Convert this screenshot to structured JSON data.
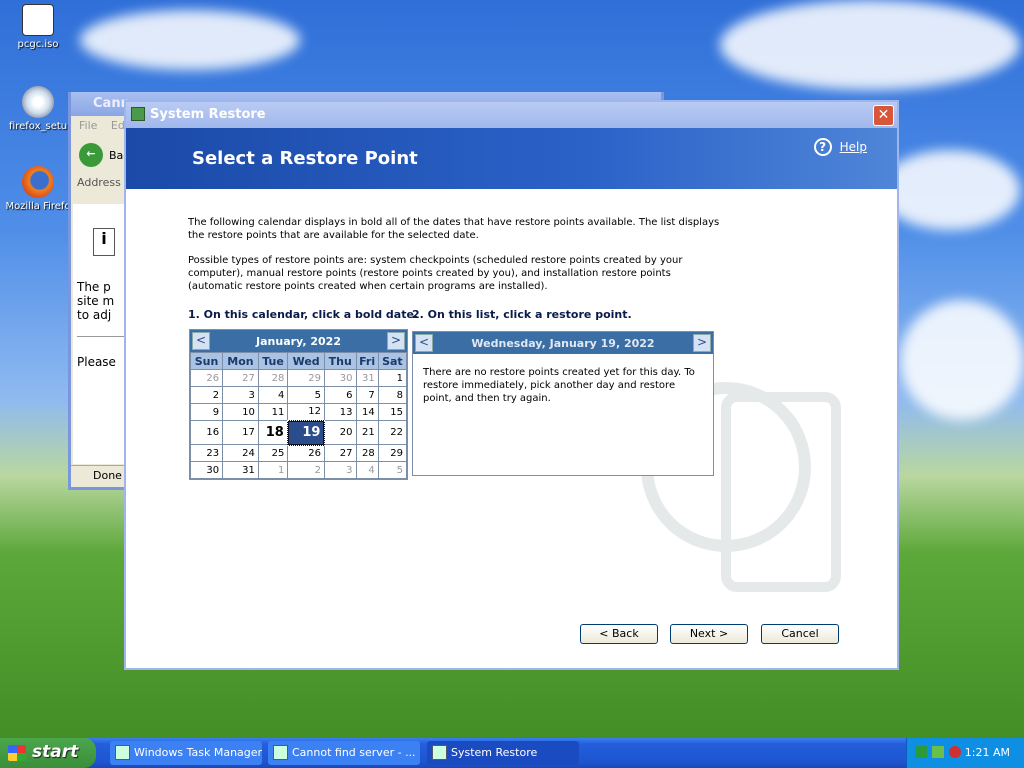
{
  "desktop": {
    "icons": [
      {
        "label": "pcgc.iso"
      },
      {
        "label": "firefox_setu"
      },
      {
        "label": "Mozilla Firefo"
      }
    ]
  },
  "ie_window": {
    "title": "Cann",
    "menu_file": "File",
    "menu_edit": "Ed",
    "back": "Bac",
    "address": "Address",
    "body_line1": "The p",
    "body_line2": "site m",
    "body_line3": "to adj",
    "body_line4": "Please",
    "status": "Done"
  },
  "system_restore": {
    "window_title": "System Restore",
    "close_label": "✕",
    "header_title": "Select a Restore Point",
    "help_label": "Help",
    "intro_p1": "The following calendar displays in bold all of the dates that have restore points available. The list displays the restore points that are available for the selected date.",
    "intro_p2": "Possible types of restore points are: system checkpoints (scheduled restore points created by your computer), manual restore points (restore points created by you), and installation restore points (automatic restore points created when certain programs are installed).",
    "step1": "1. On this calendar, click a bold date.",
    "step2": "2. On this list, click a restore point.",
    "calendar": {
      "month_label": "January, 2022",
      "prev": "<",
      "next": ">",
      "weekdays": [
        "Sun",
        "Mon",
        "Tue",
        "Wed",
        "Thu",
        "Fri",
        "Sat"
      ],
      "weeks": [
        [
          "26",
          "27",
          "28",
          "29",
          "30",
          "31",
          "1"
        ],
        [
          "2",
          "3",
          "4",
          "5",
          "6",
          "7",
          "8"
        ],
        [
          "9",
          "10",
          "11",
          "12",
          "13",
          "14",
          "15"
        ],
        [
          "16",
          "17",
          "18",
          "19",
          "20",
          "21",
          "22"
        ],
        [
          "23",
          "24",
          "25",
          "26",
          "27",
          "28",
          "29"
        ],
        [
          "30",
          "31",
          "1",
          "2",
          "3",
          "4",
          "5"
        ]
      ],
      "bold_date": "18",
      "selected_date": "19"
    },
    "list": {
      "day_label": "Wednesday, January 19, 2022",
      "prev": "<",
      "next": ">",
      "message": "There are no restore points created yet for this day. To restore immediately, pick another day and restore point, and then try again."
    },
    "buttons": {
      "back": "< Back",
      "next": "Next >",
      "cancel": "Cancel"
    }
  },
  "taskbar": {
    "start_label": "start",
    "tasks": [
      {
        "label": "Windows Task Manager"
      },
      {
        "label": "Cannot find server - ..."
      },
      {
        "label": "System Restore"
      }
    ],
    "clock": "1:21 AM"
  },
  "colors": {
    "header_blue": "#2b62c8",
    "calendar_header": "#3a6ea5",
    "selected_cell": "#2b4d8b",
    "taskbar_blue": "#245edb",
    "start_green": "#3a8f3a"
  }
}
